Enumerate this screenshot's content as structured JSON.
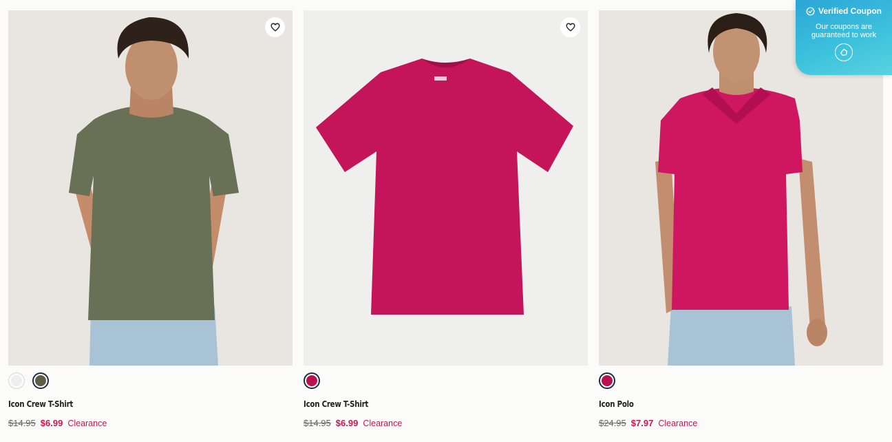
{
  "products": [
    {
      "name": "Icon Crew T-Shirt",
      "original_price": "$14.95",
      "sale_price": "$6.99",
      "badge": "Clearance",
      "swatches": [
        {
          "color": "#eeeeee",
          "selected": false
        },
        {
          "color": "#5b5e48",
          "selected": true
        }
      ],
      "icon": "heart-icon"
    },
    {
      "name": "Icon Crew T-Shirt",
      "original_price": "$14.95",
      "sale_price": "$6.99",
      "badge": "Clearance",
      "swatches": [
        {
          "color": "#b9124f",
          "selected": true
        }
      ],
      "icon": "heart-icon"
    },
    {
      "name": "Icon Polo",
      "original_price": "$24.95",
      "sale_price": "$7.97",
      "badge": "Clearance",
      "swatches": [
        {
          "color": "#b9124f",
          "selected": true
        }
      ],
      "icon": "heart-icon"
    }
  ],
  "coupon": {
    "title": "Verified Coupon",
    "text": "Our coupons are guaranteed to work",
    "icon": "check-circle-icon",
    "action_icon": "coupon-logo-icon"
  },
  "colors": {
    "sale": "#d2134b",
    "coupon_bg": "#3ec3dd"
  }
}
